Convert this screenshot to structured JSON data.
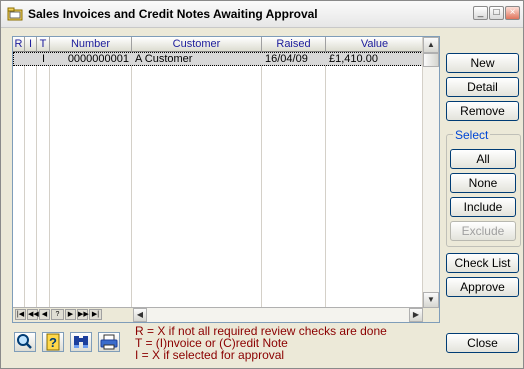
{
  "window": {
    "title": "Sales Invoices and Credit Notes Awaiting Approval",
    "minimize_icon": "minimize-icon",
    "maximize_icon": "maximize-icon",
    "close_icon": "close-icon"
  },
  "grid": {
    "columns": [
      "R",
      "I",
      "T",
      "Number",
      "Customer",
      "Raised",
      "Value"
    ],
    "rows": [
      {
        "r": "",
        "i": "",
        "t": "I",
        "number": "0000000001",
        "customer": "A Customer",
        "raised": "16/04/09",
        "value": "£1,410.00"
      }
    ]
  },
  "nav": {
    "first": "|◀",
    "prev_page": "◀◀",
    "prev": "◀",
    "help": "?",
    "next": "▶",
    "next_page": "▶▶",
    "last": "▶|"
  },
  "buttons": {
    "new": "New",
    "detail": "Detail",
    "remove": "Remove",
    "all": "All",
    "none": "None",
    "include": "Include",
    "exclude": "Exclude",
    "check_list": "Check List",
    "approve": "Approve",
    "close": "Close"
  },
  "select_group": {
    "label": "Select"
  },
  "legend": {
    "line1": "R = X if not all required review checks are done",
    "line2": "T = (I)nvoice or (C)redit Note",
    "line3": "I = X if selected for approval"
  },
  "toolbar": {
    "icons": [
      "search-icon",
      "help-icon",
      "binoculars-icon",
      "print-icon"
    ]
  },
  "colors": {
    "legend_text": "#8b0000",
    "group_label": "#0046d5",
    "header_text": "#1c1c9c"
  }
}
